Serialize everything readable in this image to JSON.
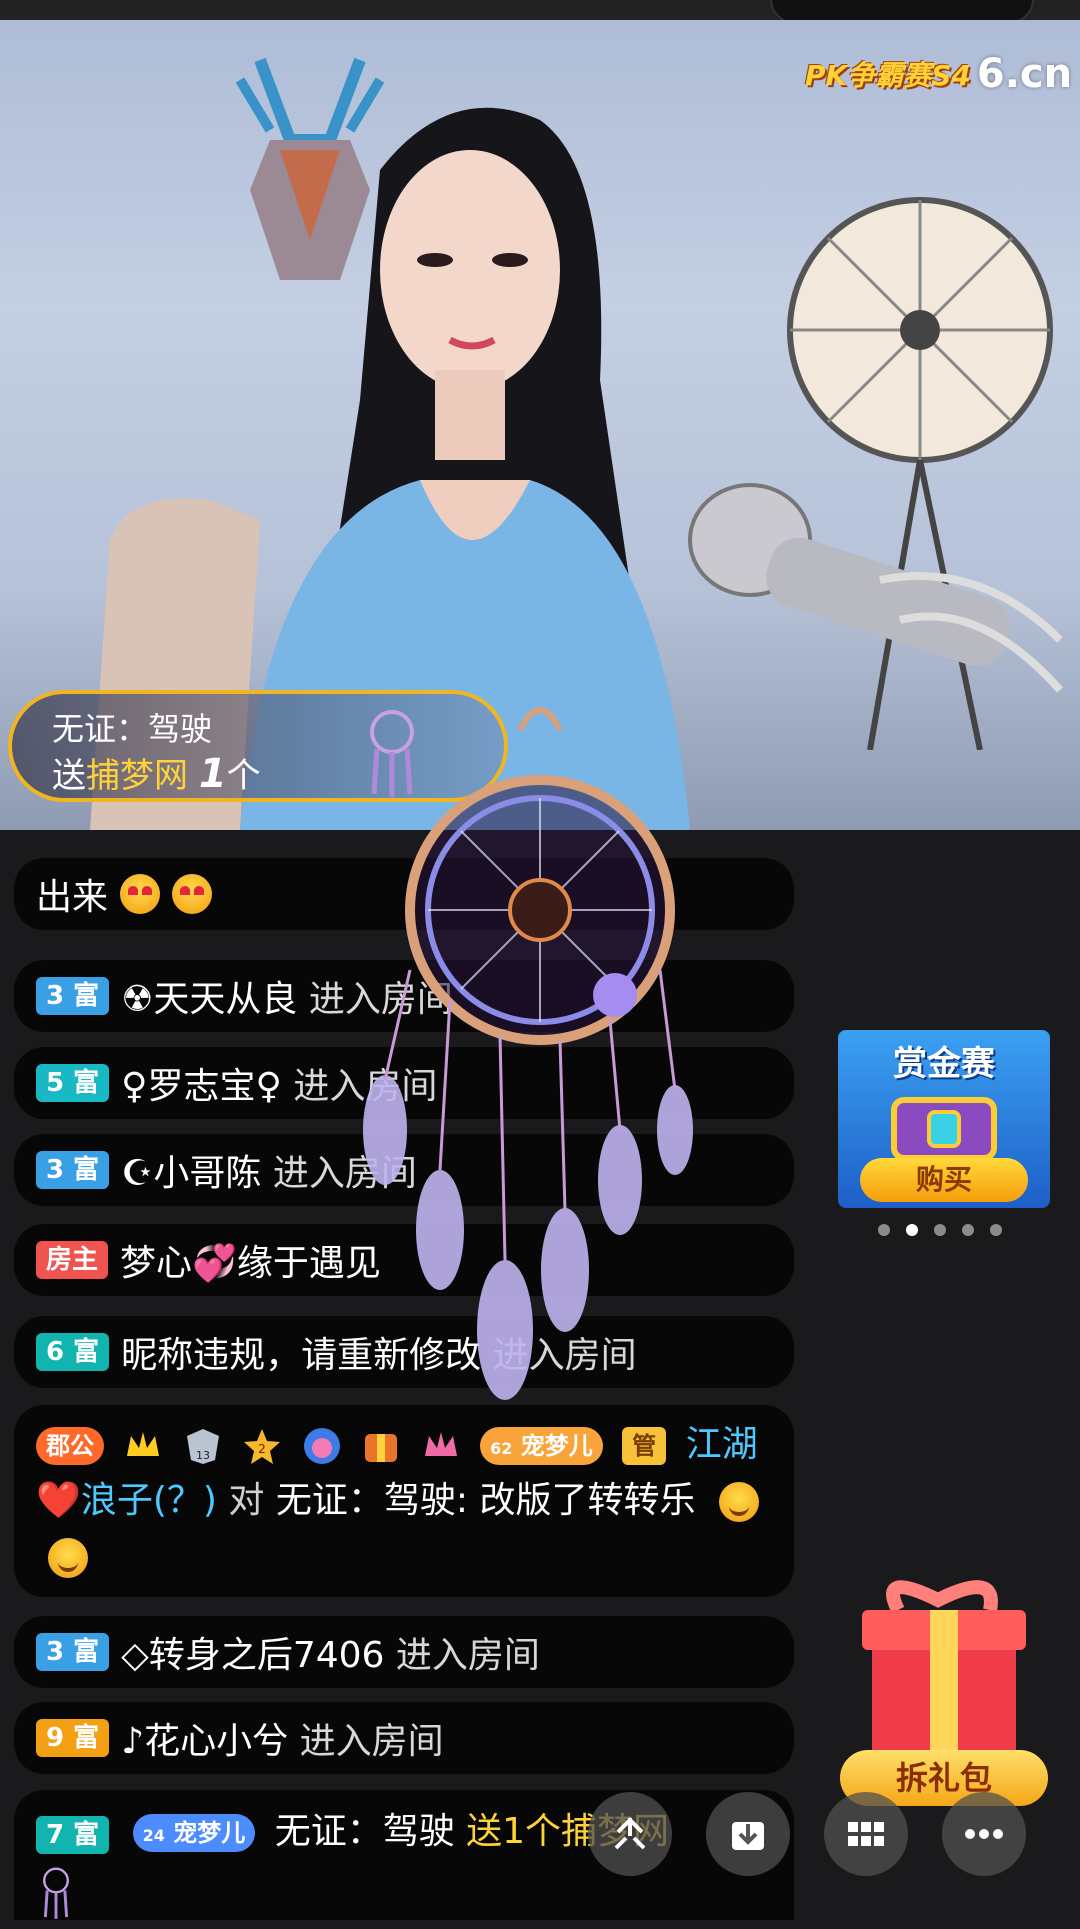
{
  "brand": {
    "pk_label": "PK争霸赛S4",
    "site": "6.cn"
  },
  "gift_banner": {
    "sender": "无证：驾驶",
    "send_word": "送",
    "gift_name": "捕梦网",
    "count": "1",
    "unit": "个"
  },
  "chat": [
    {
      "text": "出来",
      "emojis": [
        "heart-eyes",
        "heart-eyes"
      ]
    },
    {
      "badge": "3 富",
      "badge_color": "#3aa0e6",
      "name": "☢天天从良",
      "action": "进入房间"
    },
    {
      "badge": "5 富",
      "badge_color": "#18b8c4",
      "name": "♀罗志宝♀",
      "action": "进入房间"
    },
    {
      "badge": "3 富",
      "badge_color": "#3aa0e6",
      "name": "☪小哥陈",
      "action": "进入房间"
    },
    {
      "badge": "房主",
      "badge_color": "#ef5450",
      "name": "梦心💞缘于遇见",
      "action": ""
    },
    {
      "badge": "6 富",
      "badge_color": "#12b4b0",
      "name": "昵称违规，请重新修改",
      "action": "进入房间"
    },
    {
      "badge": "3 富",
      "badge_color": "#3aa0e6",
      "name": "◇转身之后7406",
      "action": "进入房间"
    },
    {
      "badge": "9 富",
      "badge_color": "#f3a015",
      "name": "♪花心小兮",
      "action": "进入房间"
    }
  ],
  "big_message": {
    "badge_prefix": "郡公",
    "badge_level": "13",
    "badge_star": "2",
    "fan_level": "62",
    "fan_club": "宠梦儿",
    "role": "管",
    "user": "江湖❤️浪子(？)",
    "to_word": "对",
    "target": "无证：驾驶:",
    "content": "改版了转转乐"
  },
  "last_message": {
    "badge": "7 富",
    "fan_level": "24",
    "fan_club": "宠梦儿",
    "user": "无证：驾驶",
    "content": "送1个捕梦网"
  },
  "promo": {
    "title": "赏金赛",
    "button": "购买",
    "dots": 5,
    "active_dot": 1
  },
  "giftbox": {
    "button": "拆礼包"
  },
  "fabs": [
    "share-icon",
    "download-icon",
    "grid-icon",
    "more-icon"
  ]
}
